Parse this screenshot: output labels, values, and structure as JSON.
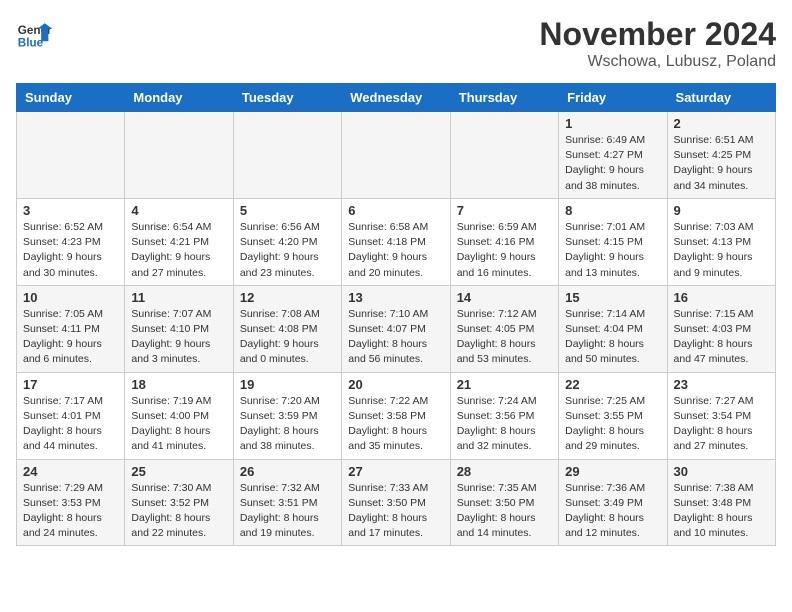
{
  "header": {
    "logo_line1": "General",
    "logo_line2": "Blue",
    "month_year": "November 2024",
    "location": "Wschowa, Lubusz, Poland"
  },
  "weekdays": [
    "Sunday",
    "Monday",
    "Tuesday",
    "Wednesday",
    "Thursday",
    "Friday",
    "Saturday"
  ],
  "weeks": [
    [
      {
        "day": "",
        "info": ""
      },
      {
        "day": "",
        "info": ""
      },
      {
        "day": "",
        "info": ""
      },
      {
        "day": "",
        "info": ""
      },
      {
        "day": "",
        "info": ""
      },
      {
        "day": "1",
        "info": "Sunrise: 6:49 AM\nSunset: 4:27 PM\nDaylight: 9 hours\nand 38 minutes."
      },
      {
        "day": "2",
        "info": "Sunrise: 6:51 AM\nSunset: 4:25 PM\nDaylight: 9 hours\nand 34 minutes."
      }
    ],
    [
      {
        "day": "3",
        "info": "Sunrise: 6:52 AM\nSunset: 4:23 PM\nDaylight: 9 hours\nand 30 minutes."
      },
      {
        "day": "4",
        "info": "Sunrise: 6:54 AM\nSunset: 4:21 PM\nDaylight: 9 hours\nand 27 minutes."
      },
      {
        "day": "5",
        "info": "Sunrise: 6:56 AM\nSunset: 4:20 PM\nDaylight: 9 hours\nand 23 minutes."
      },
      {
        "day": "6",
        "info": "Sunrise: 6:58 AM\nSunset: 4:18 PM\nDaylight: 9 hours\nand 20 minutes."
      },
      {
        "day": "7",
        "info": "Sunrise: 6:59 AM\nSunset: 4:16 PM\nDaylight: 9 hours\nand 16 minutes."
      },
      {
        "day": "8",
        "info": "Sunrise: 7:01 AM\nSunset: 4:15 PM\nDaylight: 9 hours\nand 13 minutes."
      },
      {
        "day": "9",
        "info": "Sunrise: 7:03 AM\nSunset: 4:13 PM\nDaylight: 9 hours\nand 9 minutes."
      }
    ],
    [
      {
        "day": "10",
        "info": "Sunrise: 7:05 AM\nSunset: 4:11 PM\nDaylight: 9 hours\nand 6 minutes."
      },
      {
        "day": "11",
        "info": "Sunrise: 7:07 AM\nSunset: 4:10 PM\nDaylight: 9 hours\nand 3 minutes."
      },
      {
        "day": "12",
        "info": "Sunrise: 7:08 AM\nSunset: 4:08 PM\nDaylight: 9 hours\nand 0 minutes."
      },
      {
        "day": "13",
        "info": "Sunrise: 7:10 AM\nSunset: 4:07 PM\nDaylight: 8 hours\nand 56 minutes."
      },
      {
        "day": "14",
        "info": "Sunrise: 7:12 AM\nSunset: 4:05 PM\nDaylight: 8 hours\nand 53 minutes."
      },
      {
        "day": "15",
        "info": "Sunrise: 7:14 AM\nSunset: 4:04 PM\nDaylight: 8 hours\nand 50 minutes."
      },
      {
        "day": "16",
        "info": "Sunrise: 7:15 AM\nSunset: 4:03 PM\nDaylight: 8 hours\nand 47 minutes."
      }
    ],
    [
      {
        "day": "17",
        "info": "Sunrise: 7:17 AM\nSunset: 4:01 PM\nDaylight: 8 hours\nand 44 minutes."
      },
      {
        "day": "18",
        "info": "Sunrise: 7:19 AM\nSunset: 4:00 PM\nDaylight: 8 hours\nand 41 minutes."
      },
      {
        "day": "19",
        "info": "Sunrise: 7:20 AM\nSunset: 3:59 PM\nDaylight: 8 hours\nand 38 minutes."
      },
      {
        "day": "20",
        "info": "Sunrise: 7:22 AM\nSunset: 3:58 PM\nDaylight: 8 hours\nand 35 minutes."
      },
      {
        "day": "21",
        "info": "Sunrise: 7:24 AM\nSunset: 3:56 PM\nDaylight: 8 hours\nand 32 minutes."
      },
      {
        "day": "22",
        "info": "Sunrise: 7:25 AM\nSunset: 3:55 PM\nDaylight: 8 hours\nand 29 minutes."
      },
      {
        "day": "23",
        "info": "Sunrise: 7:27 AM\nSunset: 3:54 PM\nDaylight: 8 hours\nand 27 minutes."
      }
    ],
    [
      {
        "day": "24",
        "info": "Sunrise: 7:29 AM\nSunset: 3:53 PM\nDaylight: 8 hours\nand 24 minutes."
      },
      {
        "day": "25",
        "info": "Sunrise: 7:30 AM\nSunset: 3:52 PM\nDaylight: 8 hours\nand 22 minutes."
      },
      {
        "day": "26",
        "info": "Sunrise: 7:32 AM\nSunset: 3:51 PM\nDaylight: 8 hours\nand 19 minutes."
      },
      {
        "day": "27",
        "info": "Sunrise: 7:33 AM\nSunset: 3:50 PM\nDaylight: 8 hours\nand 17 minutes."
      },
      {
        "day": "28",
        "info": "Sunrise: 7:35 AM\nSunset: 3:50 PM\nDaylight: 8 hours\nand 14 minutes."
      },
      {
        "day": "29",
        "info": "Sunrise: 7:36 AM\nSunset: 3:49 PM\nDaylight: 8 hours\nand 12 minutes."
      },
      {
        "day": "30",
        "info": "Sunrise: 7:38 AM\nSunset: 3:48 PM\nDaylight: 8 hours\nand 10 minutes."
      }
    ]
  ]
}
